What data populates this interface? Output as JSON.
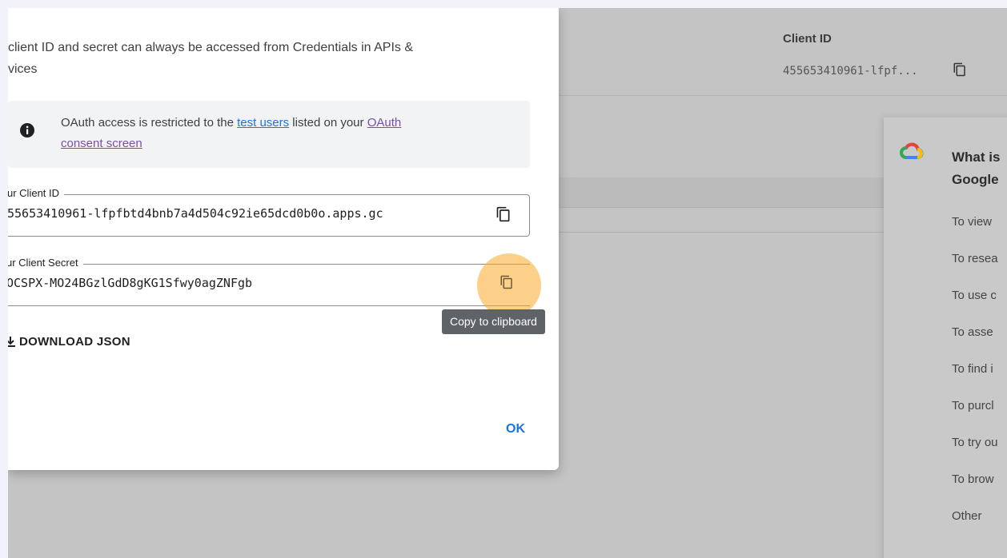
{
  "dialog": {
    "intro_line1": "client ID and secret can always be accessed from Credentials in APIs &",
    "intro_line2": "vices",
    "info": {
      "text_before": "OAuth access is restricted to the ",
      "link1": "test users",
      "text_middle": " listed on your ",
      "link2_line1": "OAuth",
      "link2_line2": "consent screen"
    },
    "client_id_label": "ur Client ID",
    "client_id_value": "55653410961-lfpfbtd4bnb7a4d504c92ie65dcd0b0o.apps.gc",
    "client_secret_label": "ur Client Secret",
    "client_secret_value": "OCSPX-MO24BGzlGdD8gKG1Sfwy0agZNFgb",
    "tooltip": "Copy to clipboard",
    "download_label": "DOWNLOAD JSON",
    "ok_label": "OK"
  },
  "background": {
    "column_header": "Client ID",
    "client_id_truncated": "455653410961-lfpf..."
  },
  "side_panel": {
    "title_line1": "What is",
    "title_line2": "Google",
    "items": [
      "To view",
      "To resea",
      "To use c",
      "To asse",
      "To find i",
      "To purcl",
      "To try ou",
      "To brow",
      "Other"
    ]
  },
  "colors": {
    "link": "#1a73e8",
    "visited_link": "#7b4fa6",
    "highlight": "#faaa28",
    "tooltip_bg": "#5f6368"
  },
  "icons": [
    "copy-icon",
    "info-icon",
    "download-icon",
    "google-cloud-logo"
  ]
}
